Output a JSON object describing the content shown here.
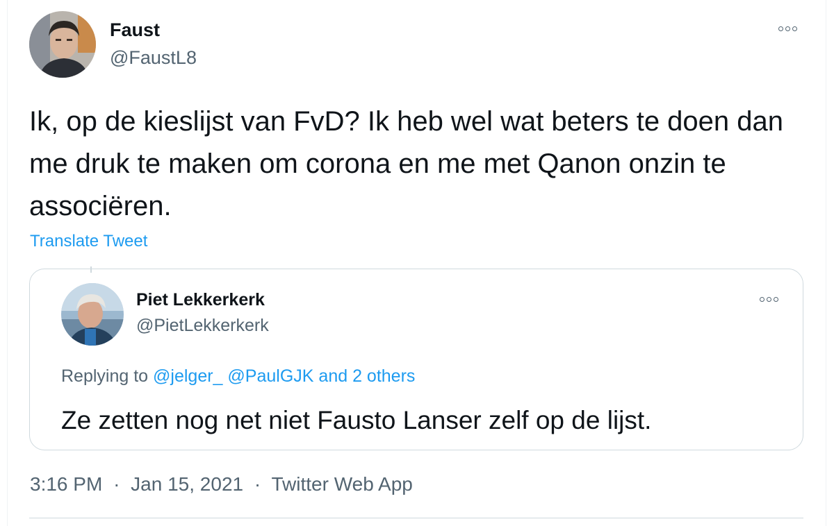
{
  "tweet": {
    "author": {
      "name": "Faust",
      "handle": "@FaustL8",
      "avatar_icon": "user-avatar"
    },
    "text": "Ik, op de kieslijst van FvD? Ik heb wel wat beters te doen dan me druk te maken om corona en me met Qanon onzin te associëren.",
    "translate_label": "Translate Tweet",
    "more_icon": "more-options-icon",
    "quoted": {
      "author": {
        "name": "Piet Lekkerkerk",
        "handle": "@PietLekkerkerk",
        "avatar_icon": "user-avatar"
      },
      "replying_prefix": "Replying to",
      "replying_mentions": [
        "@jelger_",
        "@PaulGJK"
      ],
      "replying_suffix": "and 2 others",
      "text": "Ze zetten nog net niet Fausto Lanser zelf op de lijst."
    },
    "meta": {
      "time": "3:16 PM",
      "separator": "·",
      "date": "Jan 15, 2021",
      "source": "Twitter Web App"
    }
  },
  "colors": {
    "text": "#0f1419",
    "secondary": "#536471",
    "link": "#1d9bf0",
    "border": "#cfd9de"
  }
}
